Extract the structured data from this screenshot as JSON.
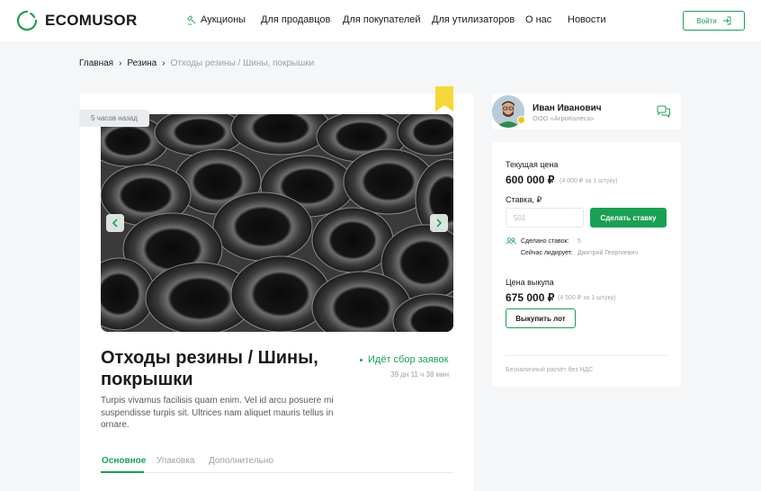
{
  "header": {
    "logo_text": "ECOMUSOR",
    "nav": [
      {
        "label": "Аукционы",
        "icon": "hammer-icon"
      },
      {
        "label": "Для продавцов"
      },
      {
        "label": "Для покупателей"
      },
      {
        "label": "Для утилизаторов"
      },
      {
        "label": "О нас"
      },
      {
        "label": "Новости"
      }
    ],
    "login_label": "Войти"
  },
  "breadcrumb": [
    "Главная",
    "Резина",
    "Отходы резины / Шины, покрышки"
  ],
  "lot": {
    "posted": "5 часов назад",
    "title": "Отходы резины / Шины, покрышки",
    "status": "Идёт сбор заявок",
    "time_left": "39 дн 11 ч 38 мин",
    "description": "Turpis vivamus facilisis quam enim. Vel id arcu posuere mi suspendisse turpis sit. Ultrices nam aliquet mauris tellus in ornare.",
    "tabs": [
      "Основное",
      "Упаковка",
      "Дополнительно"
    ],
    "active_tab": "Основное"
  },
  "seller": {
    "name": "Иван Иванович",
    "company": "ООО «АгроКолеса»"
  },
  "bid": {
    "current_price_label": "Текущая цена",
    "current_price": "600 000 ₽",
    "current_price_note": "(4 000 ₽ за 1 штуку)",
    "bid_label": "Ставка, ₽",
    "bid_placeholder": "501",
    "bid_button": "Сделать ставку",
    "bids_made_label": "Сделано ставок:",
    "bids_made_value": "5",
    "leader_label": "Сейчас лидирует:",
    "leader_value": "Дмитрий Георгиевич",
    "buyout_label": "Цена выкупа",
    "buyout_price": "675 000 ₽",
    "buyout_note": "(4 500 ₽ за 1 штуку)",
    "buyout_button": "Выкупить лот",
    "payment_note": "Безналичный расчёт без НДС"
  },
  "colors": {
    "accent": "#1aa053",
    "background": "#f4f6f8",
    "bookmark": "#f6d73a"
  }
}
